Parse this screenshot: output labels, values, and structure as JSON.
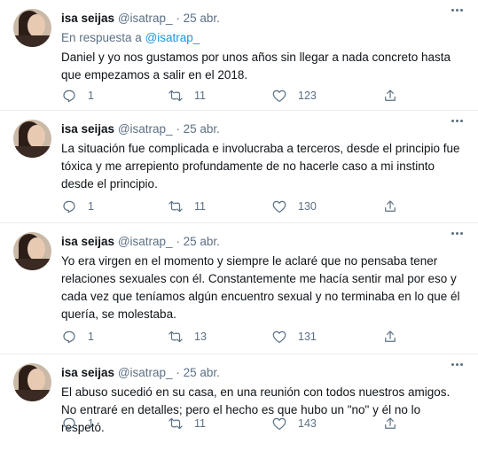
{
  "tweets": [
    {
      "name": "isa seijas",
      "handle": "@isatrap_",
      "dot": "·",
      "date": "25 abr.",
      "reply_prefix": "En respuesta a",
      "reply_mention": "@isatrap_",
      "text": "Daniel y yo nos gustamos por unos años sin llegar a nada concreto hasta que empezamos a salir en el 2018.",
      "replies": "1",
      "retweets": "11",
      "likes": "123"
    },
    {
      "name": "isa seijas",
      "handle": "@isatrap_",
      "dot": "·",
      "date": "25 abr.",
      "text": "La situación fue complicada e involucraba a terceros, desde el principio fue tóxica y me arrepiento profundamente de no hacerle caso a mi instinto desde el principio.",
      "replies": "1",
      "retweets": "11",
      "likes": "130"
    },
    {
      "name": "isa seijas",
      "handle": "@isatrap_",
      "dot": "·",
      "date": "25 abr.",
      "text": "Yo era virgen en el momento y siempre le aclaré que no pensaba tener relaciones sexuales con él. Constantemente me hacía sentir mal por eso y cada vez que teníamos algún encuentro sexual y no terminaba en lo que él quería, se molestaba.",
      "replies": "1",
      "retweets": "13",
      "likes": "131"
    },
    {
      "name": "isa seijas",
      "handle": "@isatrap_",
      "dot": "·",
      "date": "25 abr.",
      "text": "El abuso sucedió en su casa, en una reunión con todos nuestros amigos. No entraré en detalles; pero el hecho es que hubo un \"no\" y él no lo respetó.",
      "replies": "1",
      "retweets": "11",
      "likes": "143"
    }
  ],
  "colors": {
    "text": "#0f1419",
    "secondary": "#5b7083",
    "link": "#1b95e0",
    "divider": "#e6ecf0"
  },
  "icons": [
    "avatar",
    "more-icon",
    "reply-icon",
    "retweet-icon",
    "like-icon",
    "share-icon"
  ]
}
